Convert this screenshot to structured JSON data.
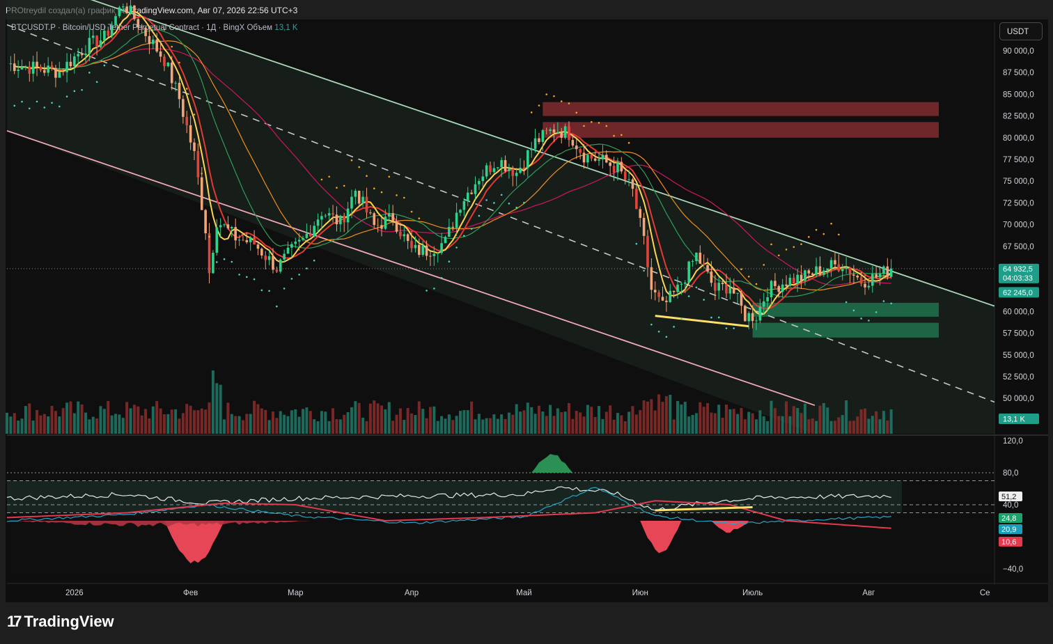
{
  "header": {
    "publisher": "PROtreydil создал(а) график на TradingView.com, Авг 07, 2026 22:56 UTC+3"
  },
  "legend": {
    "symbol": "BTCUSDT.P · Bitcoin/USD Tether Perpetual Contract · 1Д · BingX",
    "volume_label": "Объем",
    "volume_value": "13,1 K"
  },
  "currency_button": "USDT",
  "brand": {
    "name": "TradingView"
  },
  "colors": {
    "up": "#26a69a",
    "up_candle": "#2fd28a",
    "down": "#ef5350",
    "down_candle": "#e0453d",
    "background": "#0e0e0e",
    "ma_fast": "#ffd54f",
    "ma_red": "#e53935",
    "ma_green": "#2e9e5b",
    "ma_orange": "#f0901e",
    "ma_200": "#c2185b"
  },
  "chart_data": [
    {
      "type": "candlestick",
      "title": "BTCUSDT.P · Bitcoin/USD Tether Perpetual Contract · 1Д · BingX",
      "y_axis": {
        "ticks": [
          90000,
          87500,
          85000,
          82500,
          80000,
          77500,
          75000,
          72500,
          70000,
          67500,
          60000,
          57500,
          55000,
          52500,
          50000
        ],
        "tick_labels": [
          "90 000,0",
          "87 500,0",
          "85 000,0",
          "82 500,0",
          "80 000,0",
          "77 500,0",
          "75 000,0",
          "72 500,0",
          "70 000,0",
          "67 500,0",
          "60 000,0",
          "57 500,0",
          "55 000,0",
          "52 500,0",
          "50 000,0"
        ]
      },
      "x_axis": {
        "labels": [
          "2026",
          "Фев",
          "Мар",
          "Апр",
          "Май",
          "Июн",
          "Июль",
          "Авг",
          "Се"
        ],
        "label_dates": [
          "2026-01-01",
          "2026-02-01",
          "2026-03-01",
          "2026-04-01",
          "2026-05-01",
          "2026-06-01",
          "2026-07-01",
          "2026-08-01",
          "2026-09-01"
        ]
      },
      "price_labels": {
        "last_price": "64 932,5",
        "countdown": "04:03:33",
        "level": "62 245,0",
        "volume": "13,1 K"
      },
      "close_path": [
        [
          "2025-12-14",
          88500
        ],
        [
          "2025-12-22",
          88000
        ],
        [
          "2025-12-28",
          87600
        ],
        [
          "2026-01-04",
          90500
        ],
        [
          "2026-01-09",
          91500
        ],
        [
          "2026-01-14",
          95500
        ],
        [
          "2026-01-20",
          92000
        ],
        [
          "2026-01-25",
          89000
        ],
        [
          "2026-01-29",
          84500
        ],
        [
          "2026-02-02",
          78000
        ],
        [
          "2026-02-05",
          69500
        ],
        [
          "2026-02-06",
          64500
        ],
        [
          "2026-02-08",
          70500
        ],
        [
          "2026-02-13",
          68500
        ],
        [
          "2026-02-18",
          67800
        ],
        [
          "2026-02-24",
          65000
        ],
        [
          "2026-02-28",
          67000
        ],
        [
          "2026-03-03",
          68200
        ],
        [
          "2026-03-08",
          71500
        ],
        [
          "2026-03-13",
          70200
        ],
        [
          "2026-03-17",
          74000
        ],
        [
          "2026-03-22",
          69800
        ],
        [
          "2026-03-27",
          70800
        ],
        [
          "2026-04-01",
          67000
        ],
        [
          "2026-04-05",
          67000
        ],
        [
          "2026-04-10",
          68000
        ],
        [
          "2026-04-14",
          72500
        ],
        [
          "2026-04-19",
          75500
        ],
        [
          "2026-04-24",
          77500
        ],
        [
          "2026-04-29",
          76000
        ],
        [
          "2026-05-04",
          79500
        ],
        [
          "2026-05-09",
          81000
        ],
        [
          "2026-05-13",
          80500
        ],
        [
          "2026-05-17",
          78000
        ],
        [
          "2026-05-22",
          77300
        ],
        [
          "2026-05-26",
          76500
        ],
        [
          "2026-05-30",
          73800
        ],
        [
          "2026-06-02",
          68000
        ],
        [
          "2026-06-04",
          62500
        ],
        [
          "2026-06-07",
          60500
        ],
        [
          "2026-06-11",
          62500
        ],
        [
          "2026-06-16",
          66500
        ],
        [
          "2026-06-21",
          62500
        ],
        [
          "2026-06-25",
          63000
        ],
        [
          "2026-06-29",
          59500
        ],
        [
          "2026-07-02",
          59500
        ],
        [
          "2026-07-05",
          62500
        ],
        [
          "2026-07-10",
          63500
        ],
        [
          "2026-07-15",
          64000
        ],
        [
          "2026-07-20",
          65000
        ],
        [
          "2026-07-25",
          65500
        ],
        [
          "2026-07-30",
          63500
        ],
        [
          "2026-08-03",
          64000
        ],
        [
          "2026-08-07",
          64932.5
        ]
      ],
      "zones": [
        {
          "color": "resistance",
          "low": 82500,
          "high": 84100,
          "from": "2026-05-06",
          "to": "2026-09-01"
        },
        {
          "color": "resistance",
          "low": 80000,
          "high": 81800,
          "from": "2026-05-06",
          "to": "2026-09-01"
        },
        {
          "color": "support",
          "low": 59400,
          "high": 61000,
          "from": "2026-07-01",
          "to": "2026-09-01"
        },
        {
          "color": "support",
          "low": 57000,
          "high": 58700,
          "from": "2026-07-01",
          "to": "2026-09-01"
        }
      ],
      "trendlines": [
        {
          "style": "channel-top",
          "points": [
            [
              "2026-01-15",
              94500
            ],
            [
              "2026-09-01",
              61000
            ]
          ]
        },
        {
          "style": "channel-bottom",
          "points": [
            [
              "2025-12-14",
              80800
            ],
            [
              "2026-08-03",
              46800
            ]
          ]
        },
        {
          "style": "mid-dashed",
          "points": [
            [
              "2025-12-14",
              93000
            ],
            [
              "2026-09-01",
              50000
            ]
          ]
        },
        {
          "style": "divergence",
          "points": [
            [
              "2026-06-05",
              59500
            ],
            [
              "2026-06-30",
              58300
            ]
          ]
        }
      ]
    },
    {
      "type": "line",
      "y_axis": {
        "ticks": [
          120,
          80,
          40,
          -40
        ],
        "tick_labels": [
          "120,0",
          "80,0",
          "40,0",
          "−40,0"
        ]
      },
      "value_labels": [
        "51,2",
        "24,8",
        "20,9",
        "10,6"
      ],
      "series": [
        {
          "values": [
            [
              "2025-12-14",
              48
            ],
            [
              "2026-01-15",
              53
            ],
            [
              "2026-02-05",
              42
            ],
            [
              "2026-03-01",
              48
            ],
            [
              "2026-04-01",
              51
            ],
            [
              "2026-05-01",
              53
            ],
            [
              "2026-05-10",
              62
            ],
            [
              "2026-05-25",
              55
            ],
            [
              "2026-06-05",
              33
            ],
            [
              "2026-06-20",
              44
            ],
            [
              "2026-07-05",
              49
            ],
            [
              "2026-08-07",
              51.2
            ]
          ]
        },
        {
          "values": [
            [
              "2025-12-14",
              20
            ],
            [
              "2026-01-15",
              28
            ],
            [
              "2026-02-05",
              40
            ],
            [
              "2026-03-01",
              26
            ],
            [
              "2026-04-01",
              17
            ],
            [
              "2026-05-01",
              25
            ],
            [
              "2026-05-20",
              62
            ],
            [
              "2026-06-05",
              26
            ],
            [
              "2026-06-25",
              16
            ],
            [
              "2026-07-20",
              22
            ],
            [
              "2026-08-07",
              24.8
            ]
          ]
        },
        {
          "values": [
            [
              "2025-12-14",
              24
            ],
            [
              "2026-01-15",
              30
            ],
            [
              "2026-02-10",
              42
            ],
            [
              "2026-03-01",
              40
            ],
            [
              "2026-03-25",
              20
            ],
            [
              "2026-04-20",
              24
            ],
            [
              "2026-05-20",
              30
            ],
            [
              "2026-06-05",
              45
            ],
            [
              "2026-06-25",
              40
            ],
            [
              "2026-07-10",
              20
            ],
            [
              "2026-08-07",
              10.6
            ]
          ]
        }
      ]
    }
  ]
}
